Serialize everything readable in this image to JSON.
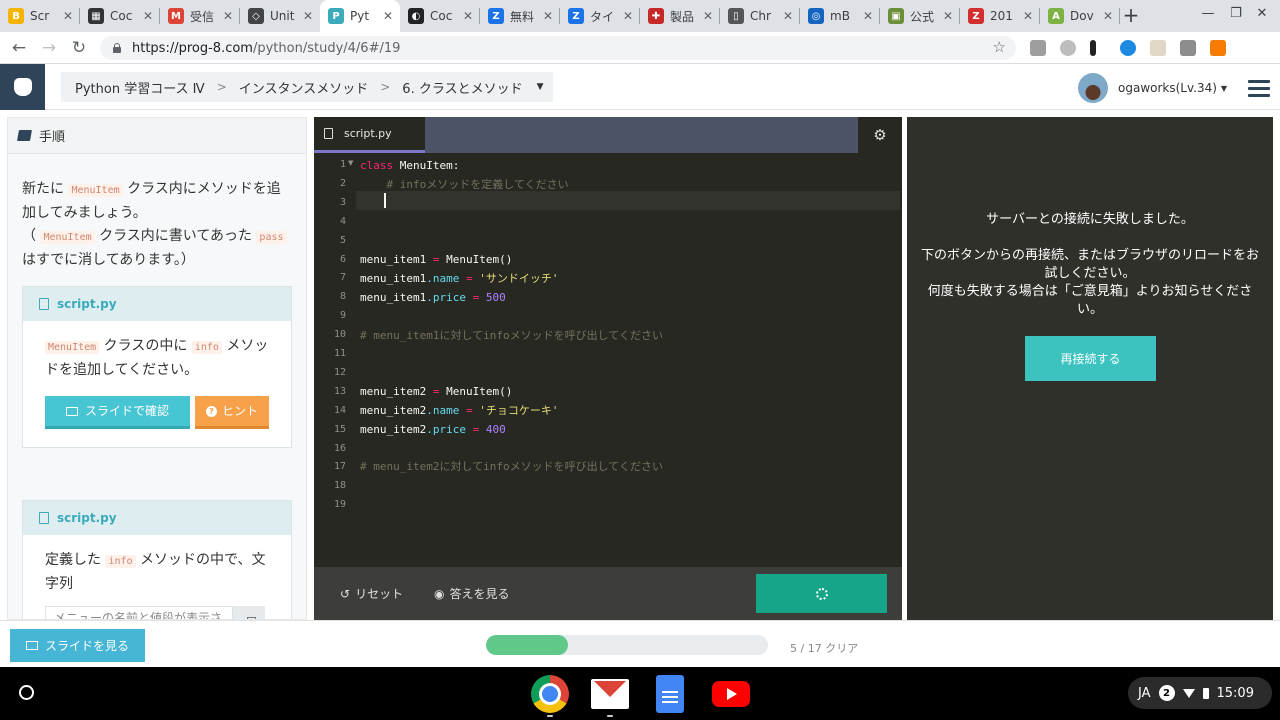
{
  "browser": {
    "tabs": [
      {
        "title": "Scr",
        "color": "#f4b400",
        "glyph": "B"
      },
      {
        "title": "Coc",
        "color": "#333333",
        "glyph": "▦"
      },
      {
        "title": "受信",
        "color": "#db4437",
        "glyph": "M"
      },
      {
        "title": "Unit",
        "color": "#444444",
        "glyph": "◇"
      },
      {
        "title": "Pyt",
        "color": "#3baabb",
        "glyph": "P"
      },
      {
        "title": "Coc",
        "color": "#222222",
        "glyph": "◐"
      },
      {
        "title": "無料",
        "color": "#1a73e8",
        "glyph": "Z"
      },
      {
        "title": "タイ",
        "color": "#1a73e8",
        "glyph": "Z"
      },
      {
        "title": "製品",
        "color": "#c62828",
        "glyph": "✚"
      },
      {
        "title": "Chr",
        "color": "#555555",
        "glyph": "▯"
      },
      {
        "title": "mB",
        "color": "#1565c0",
        "glyph": "◎"
      },
      {
        "title": "公式",
        "color": "#6d8e3a",
        "glyph": "▣"
      },
      {
        "title": "201",
        "color": "#d32f2f",
        "glyph": "Z"
      },
      {
        "title": "Dov",
        "color": "#7cb342",
        "glyph": "A"
      }
    ],
    "active_tab_index": 4,
    "url_host": "https://prog-8.com",
    "url_path": "/python/study/4/6#/19"
  },
  "header": {
    "breadcrumbs": [
      "Python 学習コース Ⅳ",
      "インスタンスメソッド",
      "6. クラスとメソッド"
    ],
    "username": "ogaworks(Lv.34)"
  },
  "instructions": {
    "title": "手順",
    "intro_parts": [
      "新たに",
      "MenuItem",
      "クラス内にメソッドを追加してみましょう。",
      "（",
      "MenuItem",
      "クラス内に書いてあった",
      "pass",
      "はすでに消してあります。）"
    ],
    "cards": [
      {
        "file": "script.py",
        "body_parts": [
          "MenuItem",
          "クラスの中に",
          "info",
          "メソッドを追加してください。"
        ],
        "slide_button": "スライドで確認",
        "hint_button": "ヒント"
      },
      {
        "file": "script.py",
        "body_parts": [
          "定義した",
          "info",
          "メソッドの中で、文字列"
        ],
        "copy_text": "メニューの名前と値段が表示されます"
      }
    ]
  },
  "editor": {
    "tab_name": "script.py",
    "line_numbers": [
      "1",
      "2",
      "3",
      "4",
      "5",
      "6",
      "7",
      "8",
      "9",
      "10",
      "11",
      "12",
      "13",
      "14",
      "15",
      "16",
      "17",
      "18",
      "19"
    ],
    "code": {
      "l1_kw": "class",
      "l1_rest": " MenuItem:",
      "l2": "    # infoメソッドを定義してください",
      "l6_a": "menu_item1",
      "l6_op": " = ",
      "l6_b": "MenuItem()",
      "l7_a": "menu_item1",
      "l7_attr": ".name",
      "l7_op": " = ",
      "l7_str": "'サンドイッチ'",
      "l8_a": "menu_item1",
      "l8_attr": ".price",
      "l8_op": " = ",
      "l8_num": "500",
      "l10": "# menu_item1に対してinfoメソッドを呼び出してください",
      "l13_a": "menu_item2",
      "l13_op": " = ",
      "l13_b": "MenuItem()",
      "l14_a": "menu_item2",
      "l14_attr": ".name",
      "l14_op": " = ",
      "l14_str": "'チョコケーキ'",
      "l15_a": "menu_item2",
      "l15_attr": ".price",
      "l15_op": " = ",
      "l15_num": "400",
      "l17": "# menu_item2に対してinfoメソッドを呼び出してください"
    },
    "reset_label": "リセット",
    "answer_label": "答えを見る"
  },
  "output": {
    "line1": "サーバーとの接続に失敗しました。",
    "line2": "下のボタンからの再接続、またはブラウザのリロードをお試しください。",
    "line3": "何度も失敗する場合は「ご意見箱」よりお知らせください。",
    "reconnect_label": "再接続する"
  },
  "footer": {
    "view_slide_label": "スライドを見る",
    "progress_fraction": 0.29,
    "progress_label": "5 / 17 クリア"
  },
  "shelf": {
    "ime": "JA",
    "notifications": "2",
    "time": "15:09"
  },
  "colors": {
    "editor_bg": "#272822",
    "accent_teal": "#3cc3c0",
    "submit_green": "#17a589",
    "hint_orange": "#f7a24a",
    "progress_green": "#60c98a"
  }
}
